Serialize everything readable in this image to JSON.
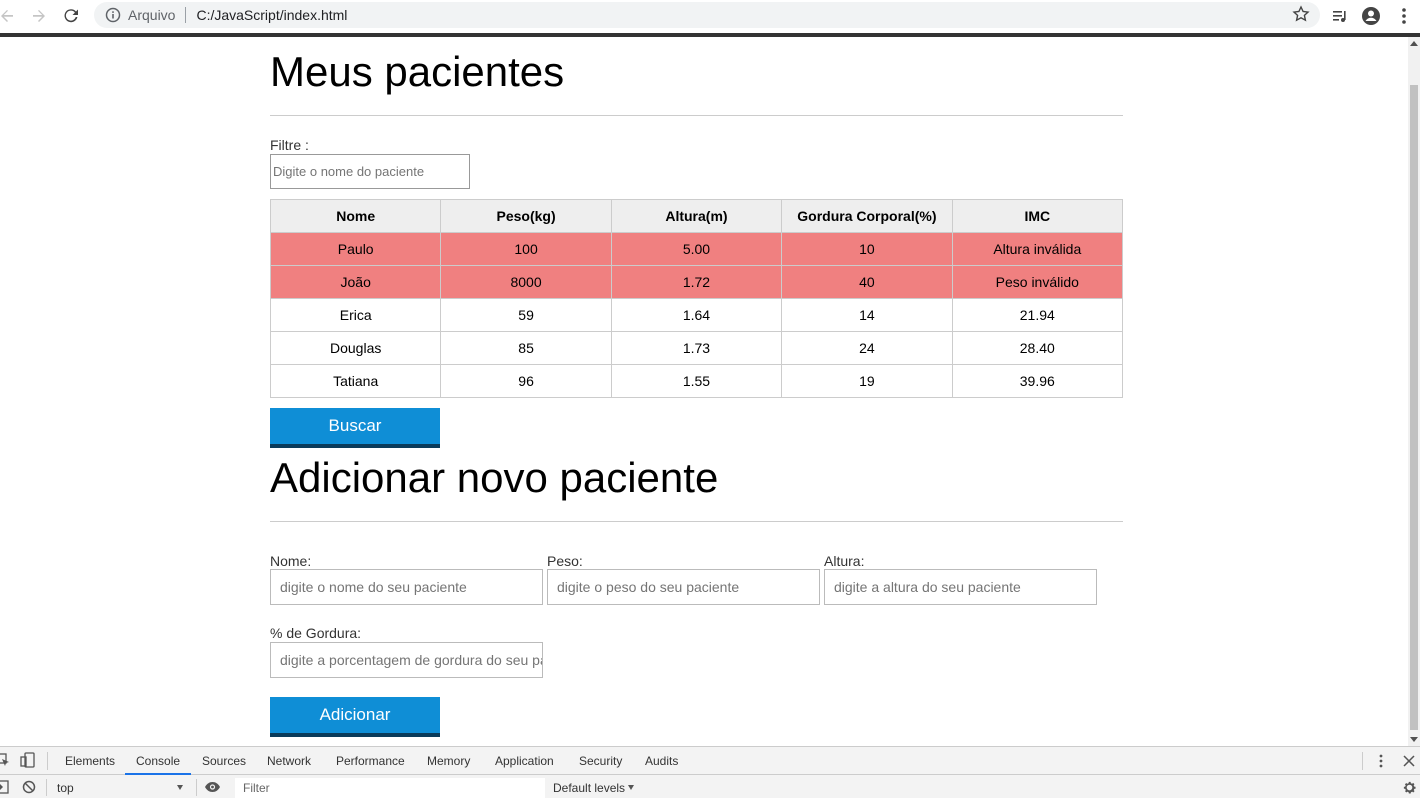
{
  "browser": {
    "scheme_label": "Arquivo",
    "url": "C:/JavaScript/index.html"
  },
  "page": {
    "title": "Meus pacientes",
    "filter": {
      "label": "Filtre :",
      "placeholder": "Digite o nome do paciente"
    },
    "table": {
      "headers": [
        "Nome",
        "Peso(kg)",
        "Altura(m)",
        "Gordura Corporal(%)",
        "IMC"
      ],
      "rows": [
        {
          "cells": [
            "Paulo",
            "100",
            "5.00",
            "10",
            "Altura inválida"
          ],
          "invalid": true
        },
        {
          "cells": [
            "João",
            "8000",
            "1.72",
            "40",
            "Peso inválido"
          ],
          "invalid": true
        },
        {
          "cells": [
            "Erica",
            "59",
            "1.64",
            "14",
            "21.94"
          ],
          "invalid": false
        },
        {
          "cells": [
            "Douglas",
            "85",
            "1.73",
            "24",
            "28.40"
          ],
          "invalid": false
        },
        {
          "cells": [
            "Tatiana",
            "96",
            "1.55",
            "19",
            "39.96"
          ],
          "invalid": false
        }
      ]
    },
    "search_button": "Buscar",
    "form": {
      "title": "Adicionar novo paciente",
      "nome_label": "Nome:",
      "nome_placeholder": "digite o nome do seu paciente",
      "peso_label": "Peso:",
      "peso_placeholder": "digite o peso do seu paciente",
      "altura_label": "Altura:",
      "altura_placeholder": "digite a altura do seu paciente",
      "gordura_label": "% de Gordura:",
      "gordura_placeholder": "digite a porcentagem de gordura do seu paciente",
      "add_button": "Adicionar"
    }
  },
  "devtools": {
    "tabs": [
      "Elements",
      "Console",
      "Sources",
      "Network",
      "Performance",
      "Memory",
      "Application",
      "Security",
      "Audits"
    ],
    "active_tab": "Console",
    "context": "top",
    "filter_placeholder": "Filter",
    "levels": "Default levels"
  },
  "colors": {
    "accent": "#0f8ed6",
    "invalid_row": "#f08080"
  }
}
